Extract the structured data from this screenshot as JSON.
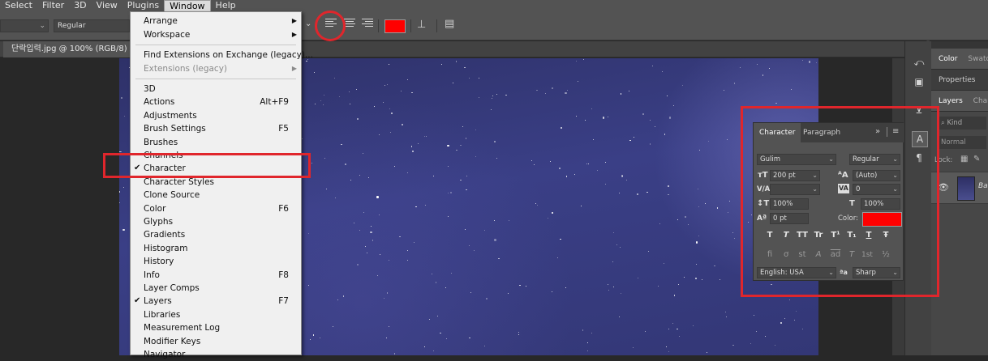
{
  "menubar": {
    "items": [
      "Select",
      "Filter",
      "3D",
      "View",
      "Plugins",
      "Window",
      "Help"
    ],
    "active": "Window"
  },
  "options": {
    "font_style": "Regular",
    "text_color": "#ff0000"
  },
  "document": {
    "tab_title": "단락입력.jpg @ 100% (RGB/8) *"
  },
  "window_menu": {
    "group1": [
      {
        "label": "Arrange",
        "submenu": true
      },
      {
        "label": "Workspace",
        "submenu": true
      }
    ],
    "group2": [
      {
        "label": "Find Extensions on Exchange (legacy)..."
      },
      {
        "label": "Extensions (legacy)",
        "submenu": true,
        "disabled": true
      }
    ],
    "group3": [
      {
        "label": "3D"
      },
      {
        "label": "Actions",
        "shortcut": "Alt+F9"
      },
      {
        "label": "Adjustments"
      },
      {
        "label": "Brush Settings",
        "shortcut": "F5"
      },
      {
        "label": "Brushes"
      },
      {
        "label": "Channels"
      },
      {
        "label": "Character",
        "checked": true
      },
      {
        "label": "Character Styles"
      },
      {
        "label": "Clone Source"
      },
      {
        "label": "Color",
        "shortcut": "F6"
      },
      {
        "label": "Glyphs"
      },
      {
        "label": "Gradients"
      },
      {
        "label": "Histogram"
      },
      {
        "label": "History"
      },
      {
        "label": "Info",
        "shortcut": "F8"
      },
      {
        "label": "Layer Comps"
      },
      {
        "label": "Layers",
        "shortcut": "F7",
        "checked": true
      },
      {
        "label": "Libraries"
      },
      {
        "label": "Measurement Log"
      },
      {
        "label": "Modifier Keys"
      },
      {
        "label": "Navigator"
      }
    ]
  },
  "right_dock": {
    "tabs_row1": [
      "Color",
      "Swatches"
    ],
    "tabs_row2": [
      "Properties"
    ],
    "tabs_row3": [
      "Layers",
      "Channels"
    ],
    "kind_placeholder": "Kind",
    "blend_mode": "Normal",
    "lock_label": "Lock:",
    "layer_name": "Background"
  },
  "character_panel": {
    "tabs": [
      "Character",
      "Paragraph"
    ],
    "font_family": "Gulim",
    "font_style": "Regular",
    "font_size": "200 pt",
    "leading": "(Auto)",
    "kerning_icon": "V/A",
    "tracking": "0",
    "vertical_scale": "100%",
    "horizontal_scale": "100%",
    "baseline_shift": "0 pt",
    "color_label": "Color:",
    "color_value": "#ff0000",
    "language": "English: USA",
    "aa_glyph": "a",
    "antialias": "Sharp",
    "style_buttons": [
      "T",
      "T",
      "TT",
      "Tr",
      "T¹",
      "T₁",
      "T",
      "Ŧ"
    ],
    "opentype_buttons": [
      "fi",
      "ơ",
      "st",
      "A",
      "ad",
      "T",
      "1st",
      "½"
    ]
  },
  "colors": {
    "highlight": "#e0262c",
    "menu_bg": "#f0f0f0",
    "ui_dark": "#535353"
  }
}
